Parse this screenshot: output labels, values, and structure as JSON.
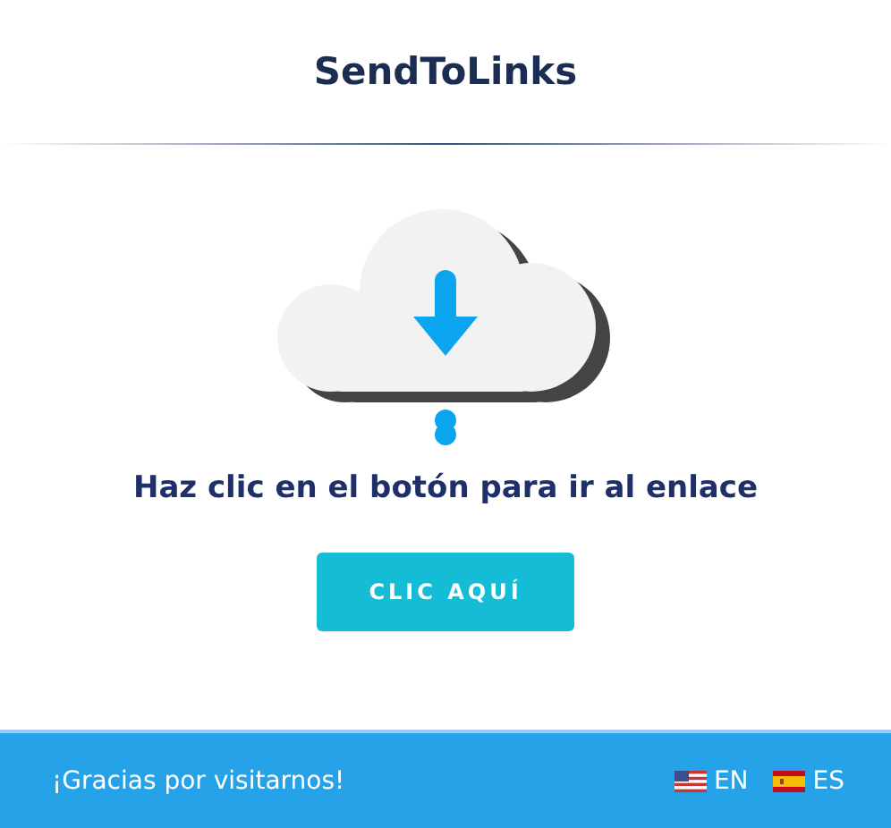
{
  "header": {
    "title": "SendToLinks"
  },
  "main": {
    "heading": "Haz clic en el botón para ir al enlace",
    "button": "CLIC AQUÍ"
  },
  "footer": {
    "text": "¡Gracias por visitarnos!",
    "languages": [
      {
        "code": "EN",
        "kind": "us"
      },
      {
        "code": "ES",
        "kind": "es"
      }
    ]
  }
}
